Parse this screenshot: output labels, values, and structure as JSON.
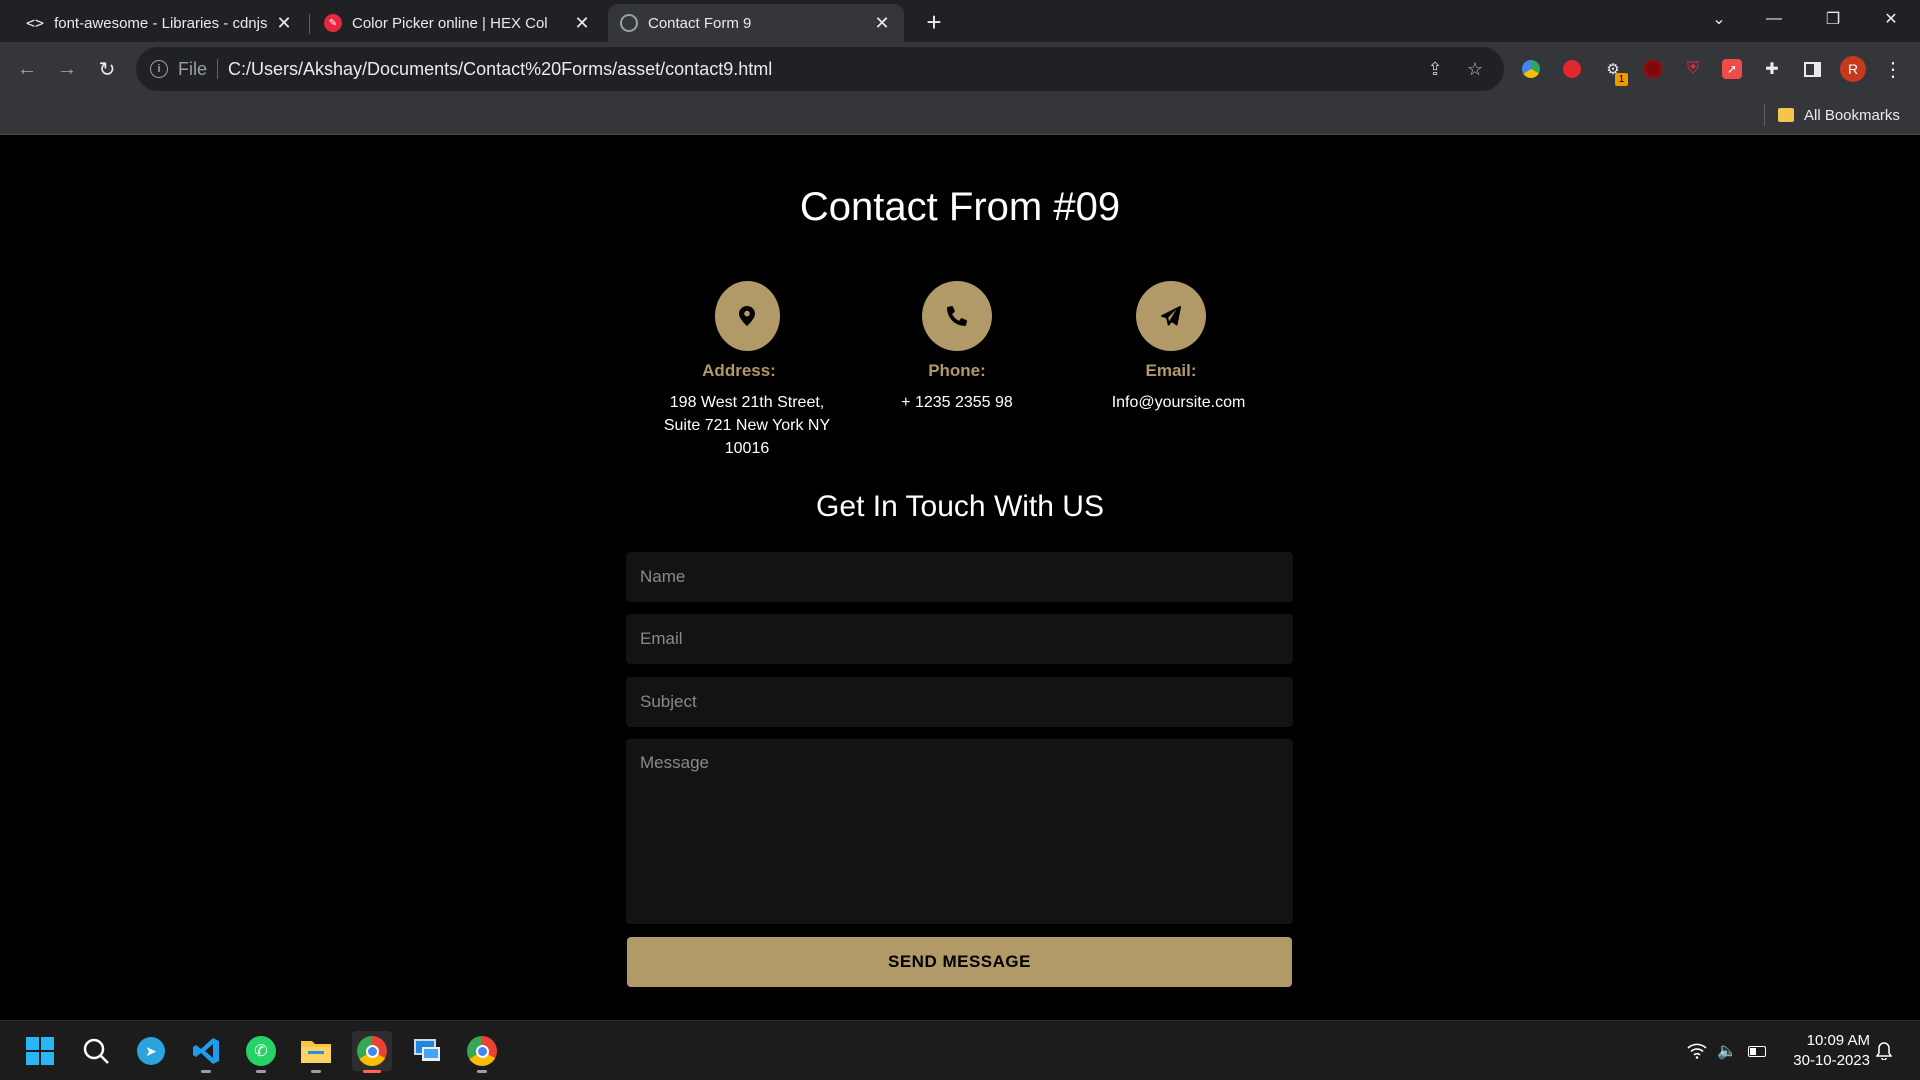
{
  "browser": {
    "tabs": [
      {
        "title": "font-awesome - Libraries - cdnjs",
        "icon": "code-icon",
        "active": false
      },
      {
        "title": "Color Picker online | HEX Col",
        "icon": "color-picker-icon",
        "active": false
      },
      {
        "title": "Contact Form 9",
        "icon": "globe-icon",
        "active": true
      }
    ],
    "address": {
      "scheme_label": "File",
      "url": "C:/Users/Akshay/Documents/Contact%20Forms/asset/contact9.html"
    },
    "profile_initial": "R",
    "extension_badge": "1",
    "bookmarks": {
      "all_label": "All Bookmarks"
    }
  },
  "page": {
    "title": "Contact From #09",
    "accent_color": "#b29968",
    "contact_info": [
      {
        "label": "Address:",
        "value": "198 West 21th Street, Suite 721 New York NY 10016",
        "icon": "map-marker-icon"
      },
      {
        "label": "Phone:",
        "value": "+ 1235 2355 98",
        "icon": "phone-icon"
      },
      {
        "label": "Email:",
        "value": "Info@yoursite.com",
        "icon": "paper-plane-icon"
      }
    ],
    "form": {
      "heading": "Get In Touch With US",
      "name_placeholder": "Name",
      "email_placeholder": "Email",
      "subject_placeholder": "Subject",
      "message_placeholder": "Message",
      "submit_label": "SEND MESSAGE"
    }
  },
  "taskbar": {
    "apps": [
      "windows-start-icon",
      "search-icon",
      "telegram-icon",
      "vscode-icon",
      "whatsapp-icon",
      "file-explorer-icon",
      "chrome-icon",
      "remote-desktop-icon",
      "chrome-icon"
    ],
    "time": "10:09 AM",
    "date": "30-10-2023"
  }
}
